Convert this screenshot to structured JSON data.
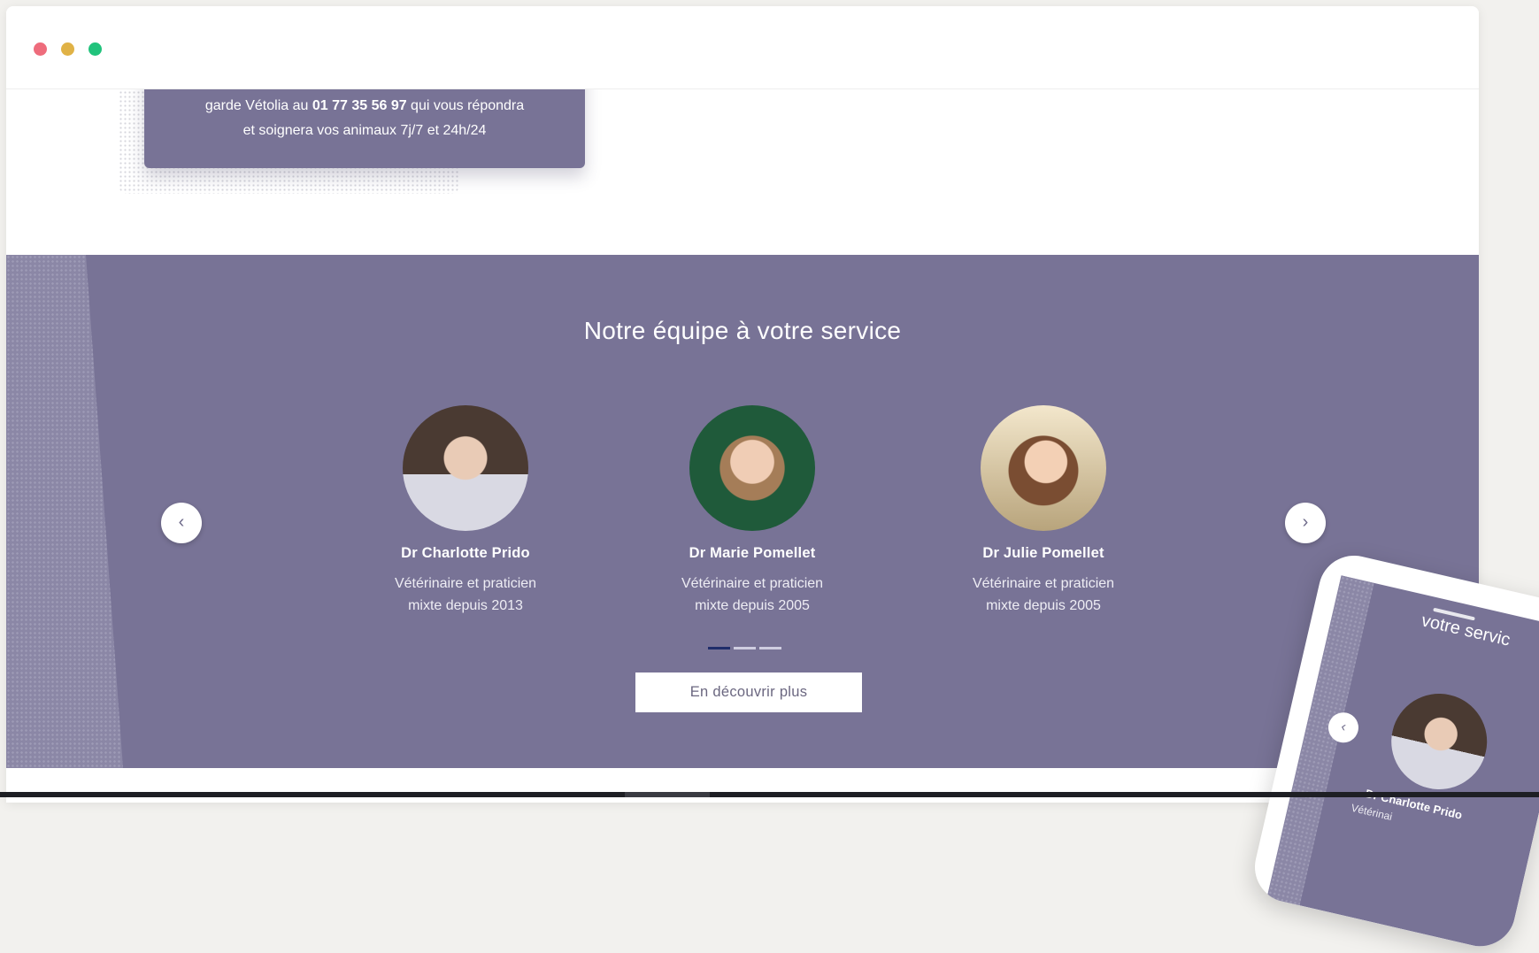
{
  "info_card": {
    "line1_prefix": "garde Vétolia au ",
    "line1_phone": "01 77 35 56 97",
    "line1_suffix": " qui vous répondra",
    "line2": "et soignera vos animaux 7j/7 et 24h/24"
  },
  "team": {
    "title": "Notre équipe à votre service",
    "prev_icon": "‹",
    "next_icon": "›",
    "members": [
      {
        "name": "Dr Charlotte Prido",
        "role_line1": "Vétérinaire et praticien",
        "role_line2": "mixte depuis 2013"
      },
      {
        "name": "Dr Marie Pomellet",
        "role_line1": "Vétérinaire et praticien",
        "role_line2": "mixte depuis 2005"
      },
      {
        "name": "Dr Julie Pomellet",
        "role_line1": "Vétérinaire et praticien",
        "role_line2": "mixte depuis 2005"
      }
    ],
    "active_slide": 1,
    "slide_count": 3,
    "more_button": "En découvrir plus"
  },
  "phone_preview": {
    "title": "votre servic",
    "prev_icon": "‹",
    "member_name": "Dr Charlotte Prido",
    "member_role": "Vétérinai"
  },
  "colors": {
    "section_bg": "#787396",
    "indicator_active": "#1f2d6b",
    "indicator_inactive": "#cfcde0"
  }
}
